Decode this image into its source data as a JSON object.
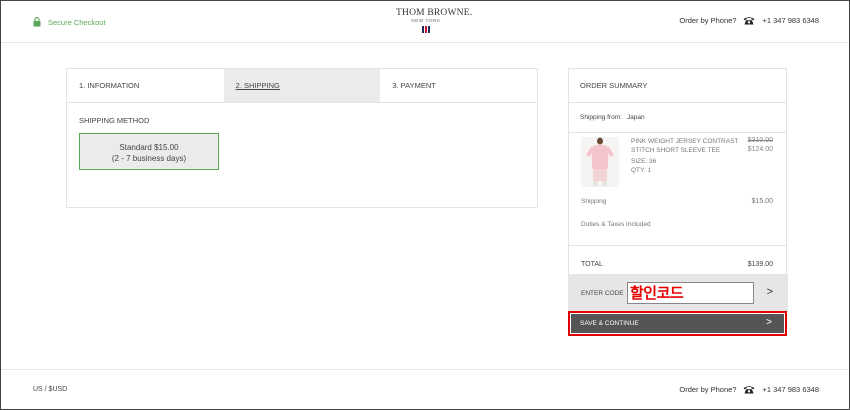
{
  "header": {
    "secure_checkout": "Secure Checkout",
    "brand_name": "THOM BROWNE.",
    "brand_sub": "NEW YORK",
    "order_by_phone": "Order by Phone?",
    "phone_number": "+1 347 983 6348",
    "flag_colors": [
      "#1a2d5c",
      "#ffffff",
      "#c8102e"
    ],
    "accent_green": "#5aa95a"
  },
  "steps": [
    {
      "label": "1. INFORMATION",
      "active": false
    },
    {
      "label": "2. SHIPPING",
      "active": true
    },
    {
      "label": "3. PAYMENT",
      "active": false
    }
  ],
  "shipping": {
    "method_label": "SHIPPING METHOD",
    "option_line1": "Standard $15.00",
    "option_line2": "(2 - 7 business days)"
  },
  "summary": {
    "title": "ORDER SUMMARY",
    "ship_from_label": "Shipping from:",
    "ship_from_value": "Japan",
    "item": {
      "name": "PINK WEIGHT JERSEY CONTRAST STITCH SHORT SLEEVE TEE",
      "size": "SIZE: 36",
      "qty": "QTY: 1",
      "price_original": "$310.00",
      "price_sale": "$124.00"
    },
    "shipping_label": "Shipping",
    "shipping_value": "$15.00",
    "duties": "Duties & Taxes Included",
    "total_label": "TOTAL",
    "total_value": "$139.00",
    "promo_label": "ENTER CODE",
    "promo_value": "할인코드",
    "promo_arrow": ">",
    "save_label": "SAVE & CONTINUE",
    "save_arrow": ">"
  },
  "footer": {
    "currency": "US / $USD",
    "order_by_phone": "Order by Phone?",
    "phone_number": "+1 347 983 6348"
  },
  "icons": {
    "lock": "lock-icon",
    "phone": "phone-icon",
    "flag": "flag-icon"
  }
}
